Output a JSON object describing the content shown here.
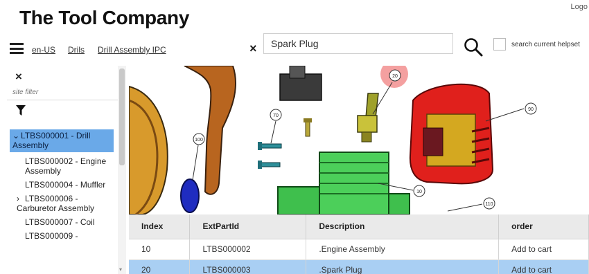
{
  "header": {
    "brand": "The Tool Company",
    "logout": "Logo"
  },
  "toolbar": {
    "breadcrumbs": [
      "en-US",
      "Drils",
      "Drill Assembly IPC"
    ],
    "search": {
      "value": "Spark Plug",
      "clear_label": "×"
    },
    "help_label": "search current helpset"
  },
  "sidebar": {
    "close_label": "×",
    "filter_placeholder": "site filter",
    "tree": [
      {
        "label": "LTBS000001 - Drill Assembly",
        "caret": "⌄",
        "selected": true
      },
      {
        "label": "LTBS000002 - Engine Assembly",
        "caret": ""
      },
      {
        "label": "LTBS000004 - Muffler",
        "caret": ""
      },
      {
        "label": "LTBS000006 - Carburetor Assembly",
        "caret": "›"
      },
      {
        "label": "LTBS000007 - Coil",
        "caret": ""
      },
      {
        "label": "LTBS000009 -",
        "caret": ""
      }
    ]
  },
  "viewer": {
    "callouts": [
      "20",
      "70",
      "100",
      "10",
      "110",
      "90"
    ]
  },
  "table": {
    "headers": [
      "Index",
      "ExtPartId",
      "Description",
      "order"
    ],
    "rows": [
      {
        "index": "10",
        "part": "LTBS000002",
        "description": ".Engine Assembly",
        "order": "Add to cart",
        "selected": false
      },
      {
        "index": "20",
        "part": "LTBS000003",
        "description": ".Spark Plug",
        "order": "Add to cart",
        "selected": true
      }
    ]
  },
  "colors": {
    "selection": "#6aa9e8",
    "row_selected": "#a9cff3",
    "part_green": "#4ccf5a",
    "part_red": "#e0201c",
    "part_orange": "#c47a28"
  }
}
